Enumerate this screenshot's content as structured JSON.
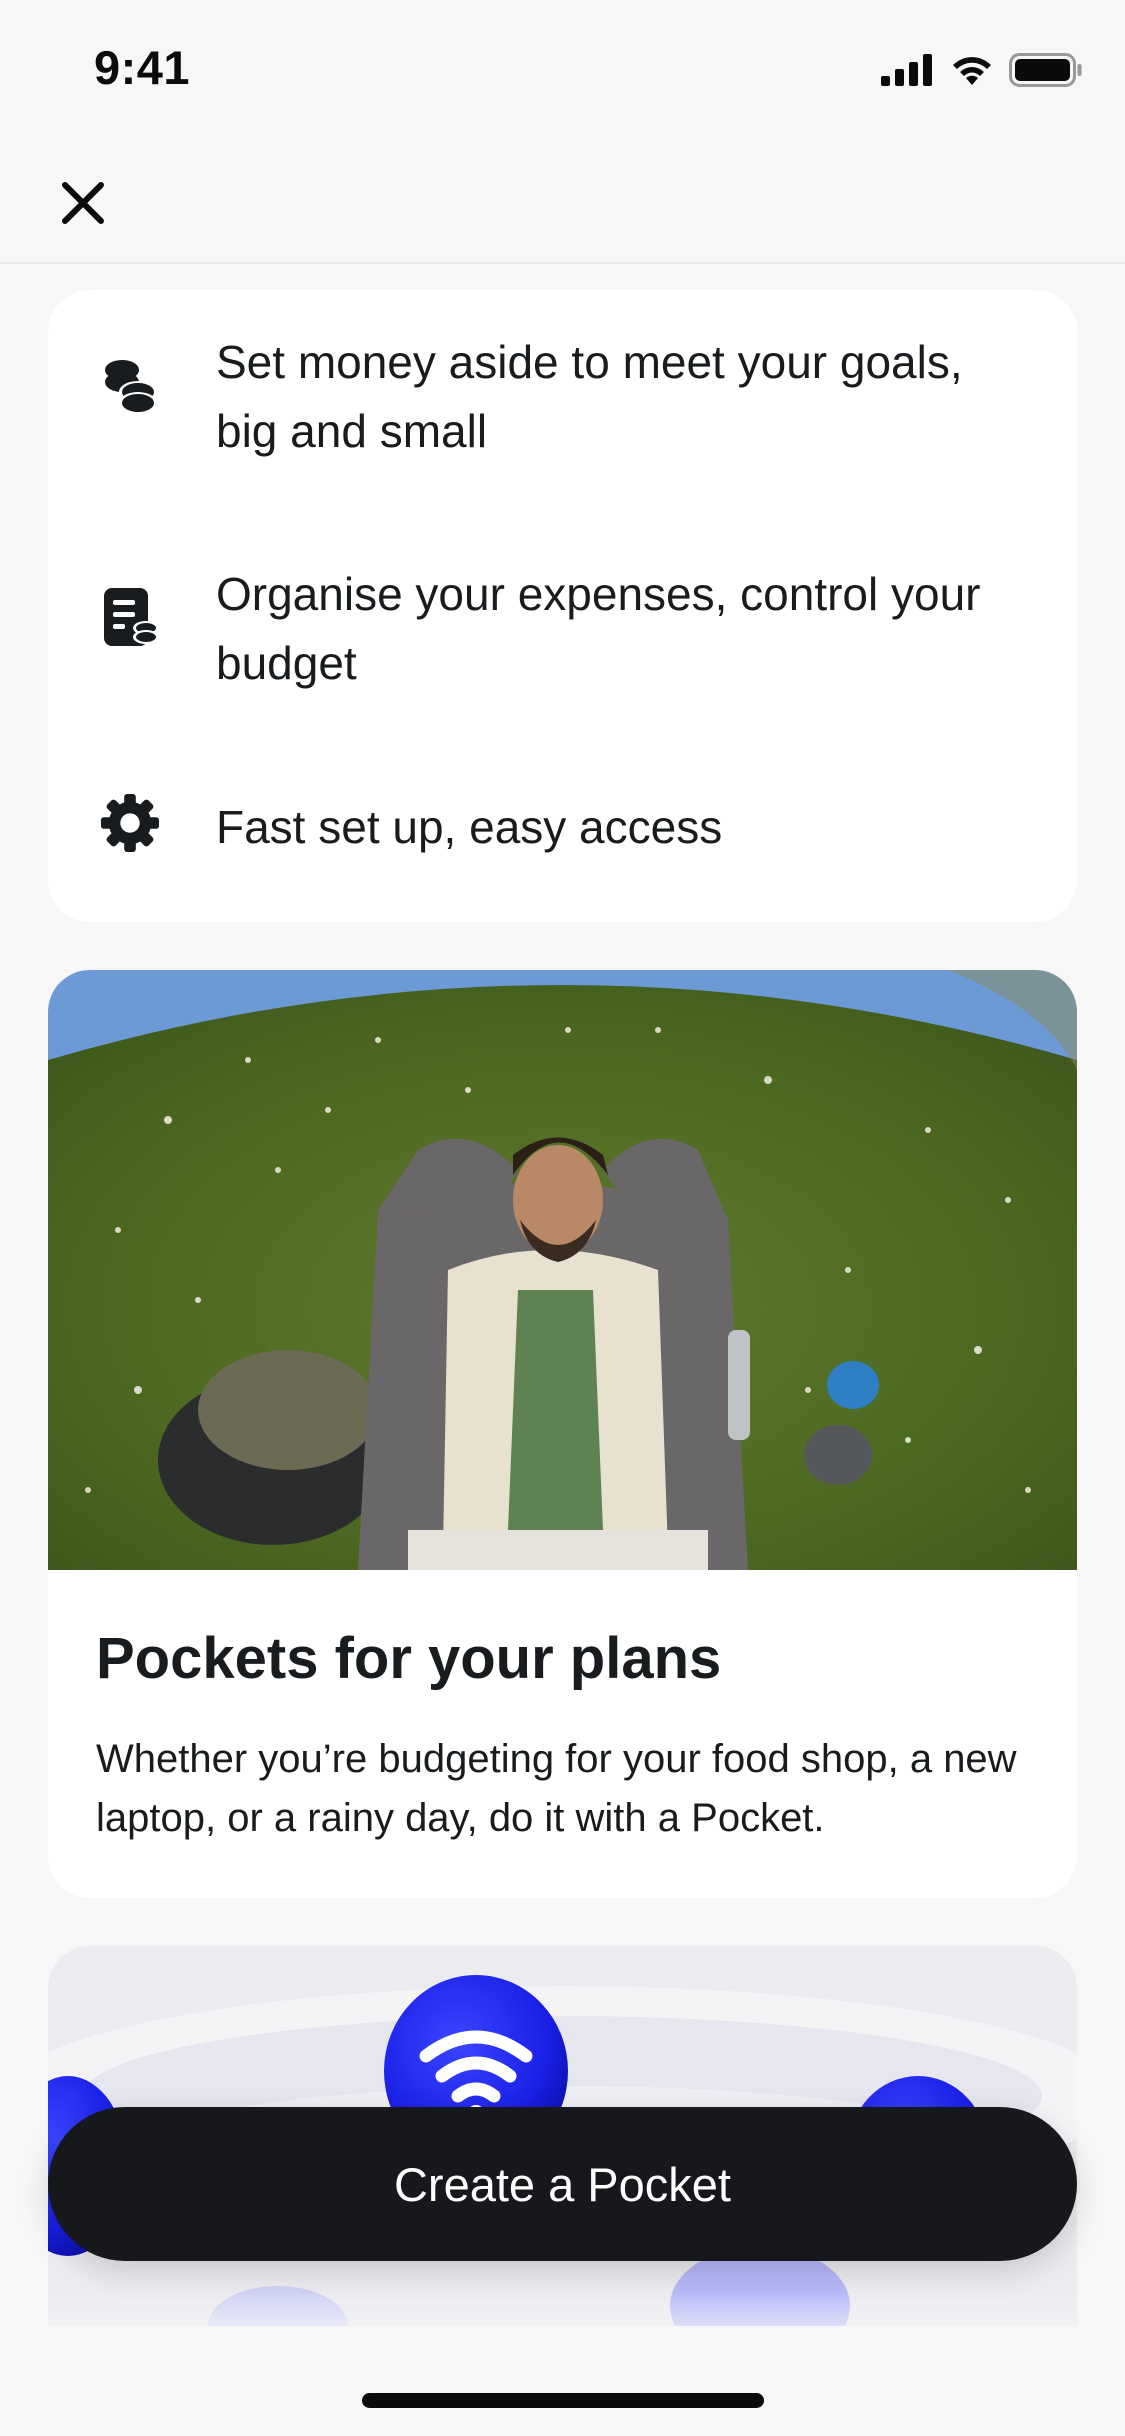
{
  "status_bar": {
    "time": "9:41"
  },
  "header": {
    "close_icon": "close-icon"
  },
  "features": [
    {
      "icon": "coins-icon",
      "text": "Set money aside to meet your goals, big and small"
    },
    {
      "icon": "budget-icon",
      "text": "Organise your expenses, control your budget"
    },
    {
      "icon": "gear-icon",
      "text": "Fast set up, easy access"
    }
  ],
  "promo": {
    "image": "man-lying-on-grass-photo",
    "title": "Pockets for your plans",
    "body": "Whether you’re budgeting for your food shop, a new laptop, or a rainy day, do it with a Pocket."
  },
  "coins_card": {
    "image": "contactless-coins-illustration"
  },
  "cta": {
    "label": "Create a Pocket"
  },
  "colors": {
    "background": "#f7f7f8",
    "card": "#ffffff",
    "text": "#191c1f",
    "button": "#16181c",
    "accent_blue": "#1a1fe6"
  }
}
